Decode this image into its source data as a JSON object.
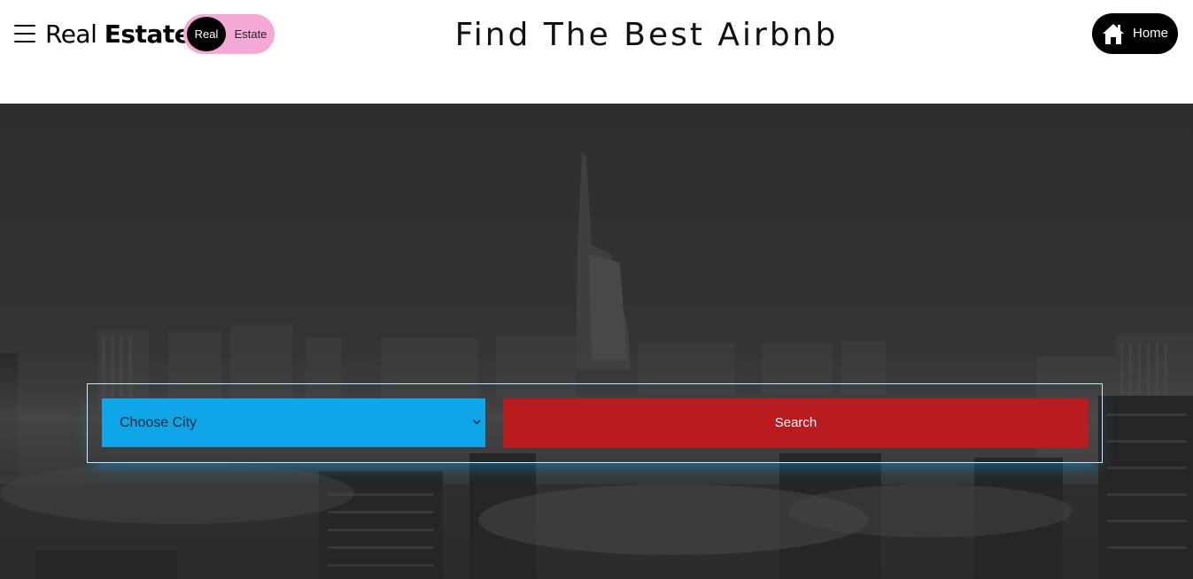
{
  "header": {
    "menu_icon": "hamburger-menu-icon",
    "brand": {
      "light": "Real",
      "bold": "Estate"
    },
    "toggle": {
      "active_label": "Real",
      "inactive_label": "Estate",
      "color": "#f4a9d6"
    },
    "title": "Find The Best Airbnb",
    "home_button": {
      "label": "Home",
      "icon": "house-icon"
    }
  },
  "hero": {
    "background": "grayscale-city-skyline-in-fog",
    "search": {
      "select_value": "Choose City",
      "select_color": "#0ea5e9",
      "button_label": "Search",
      "button_color": "#b91c1f"
    }
  }
}
